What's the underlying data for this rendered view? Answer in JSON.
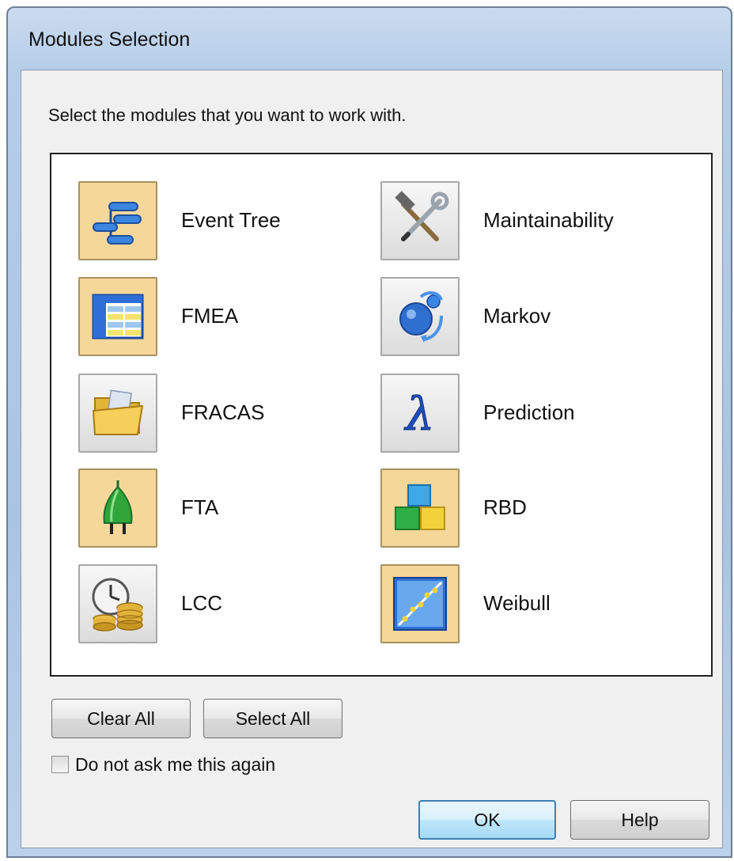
{
  "window": {
    "title": "Modules Selection"
  },
  "instruction": "Select the modules that you want to work with.",
  "modules_left": [
    {
      "label": "Event Tree",
      "icon": "event-tree-icon",
      "selected": true
    },
    {
      "label": "FMEA",
      "icon": "fmea-table-icon",
      "selected": true
    },
    {
      "label": "FRACAS",
      "icon": "folder-icon",
      "selected": false
    },
    {
      "label": "FTA",
      "icon": "fault-tree-plug-icon",
      "selected": true
    },
    {
      "label": "LCC",
      "icon": "clock-coins-icon",
      "selected": false
    }
  ],
  "modules_right": [
    {
      "label": "Maintainability",
      "icon": "hammer-wrench-icon",
      "selected": false
    },
    {
      "label": "Markov",
      "icon": "markov-sphere-icon",
      "selected": false
    },
    {
      "label": "Prediction",
      "icon": "lambda-icon",
      "selected": false
    },
    {
      "label": "RBD",
      "icon": "blocks-icon",
      "selected": true
    },
    {
      "label": "Weibull",
      "icon": "weibull-plot-icon",
      "selected": true
    }
  ],
  "buttons": {
    "clear_all": "Clear All",
    "select_all": "Select All",
    "ok": "OK",
    "help": "Help"
  },
  "checkbox": {
    "label": "Do not ask me this again",
    "checked": false
  },
  "colors": {
    "selected_tile": "#f6d79a",
    "panel_border": "#222222",
    "default_button": "#3c7fb1"
  }
}
